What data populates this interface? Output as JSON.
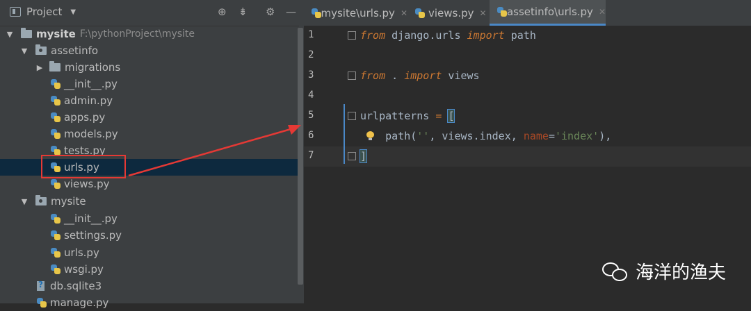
{
  "project_panel": {
    "title": "Project",
    "buttons": [
      "locate-icon",
      "collapse-icon",
      "gear-icon",
      "hide-icon"
    ]
  },
  "tree": [
    {
      "label": "mysite",
      "path": "F:\\pythonProject\\mysite",
      "type": "root",
      "expanded": true
    },
    {
      "label": "assetinfo",
      "type": "package",
      "expanded": true
    },
    {
      "label": "migrations",
      "type": "folder",
      "expanded": false
    },
    {
      "label": "__init__.py",
      "type": "py"
    },
    {
      "label": "admin.py",
      "type": "py"
    },
    {
      "label": "apps.py",
      "type": "py"
    },
    {
      "label": "models.py",
      "type": "py"
    },
    {
      "label": "tests.py",
      "type": "py"
    },
    {
      "label": "urls.py",
      "type": "py",
      "selected": true
    },
    {
      "label": "views.py",
      "type": "py"
    },
    {
      "label": "mysite",
      "type": "package",
      "expanded": true
    },
    {
      "label": "__init__.py",
      "type": "py"
    },
    {
      "label": "settings.py",
      "type": "py"
    },
    {
      "label": "urls.py",
      "type": "py"
    },
    {
      "label": "wsgi.py",
      "type": "py"
    },
    {
      "label": "db.sqlite3",
      "type": "db"
    },
    {
      "label": "manage.py",
      "type": "py"
    }
  ],
  "tabs": [
    {
      "label": "mysite\\urls.py",
      "active": false
    },
    {
      "label": "views.py",
      "active": false
    },
    {
      "label": "assetinfo\\urls.py",
      "active": true
    }
  ],
  "editor": {
    "line_numbers": [
      "1",
      "2",
      "3",
      "4",
      "5",
      "6",
      "7"
    ],
    "current_line": 7
  },
  "colors": {
    "accent": "#4a88c7",
    "keyword": "#cc7832",
    "string": "#6a8759",
    "highlight_box": "#e53935"
  },
  "watermark": {
    "text": "海洋的渔夫",
    "icon": "wechat-icon"
  }
}
